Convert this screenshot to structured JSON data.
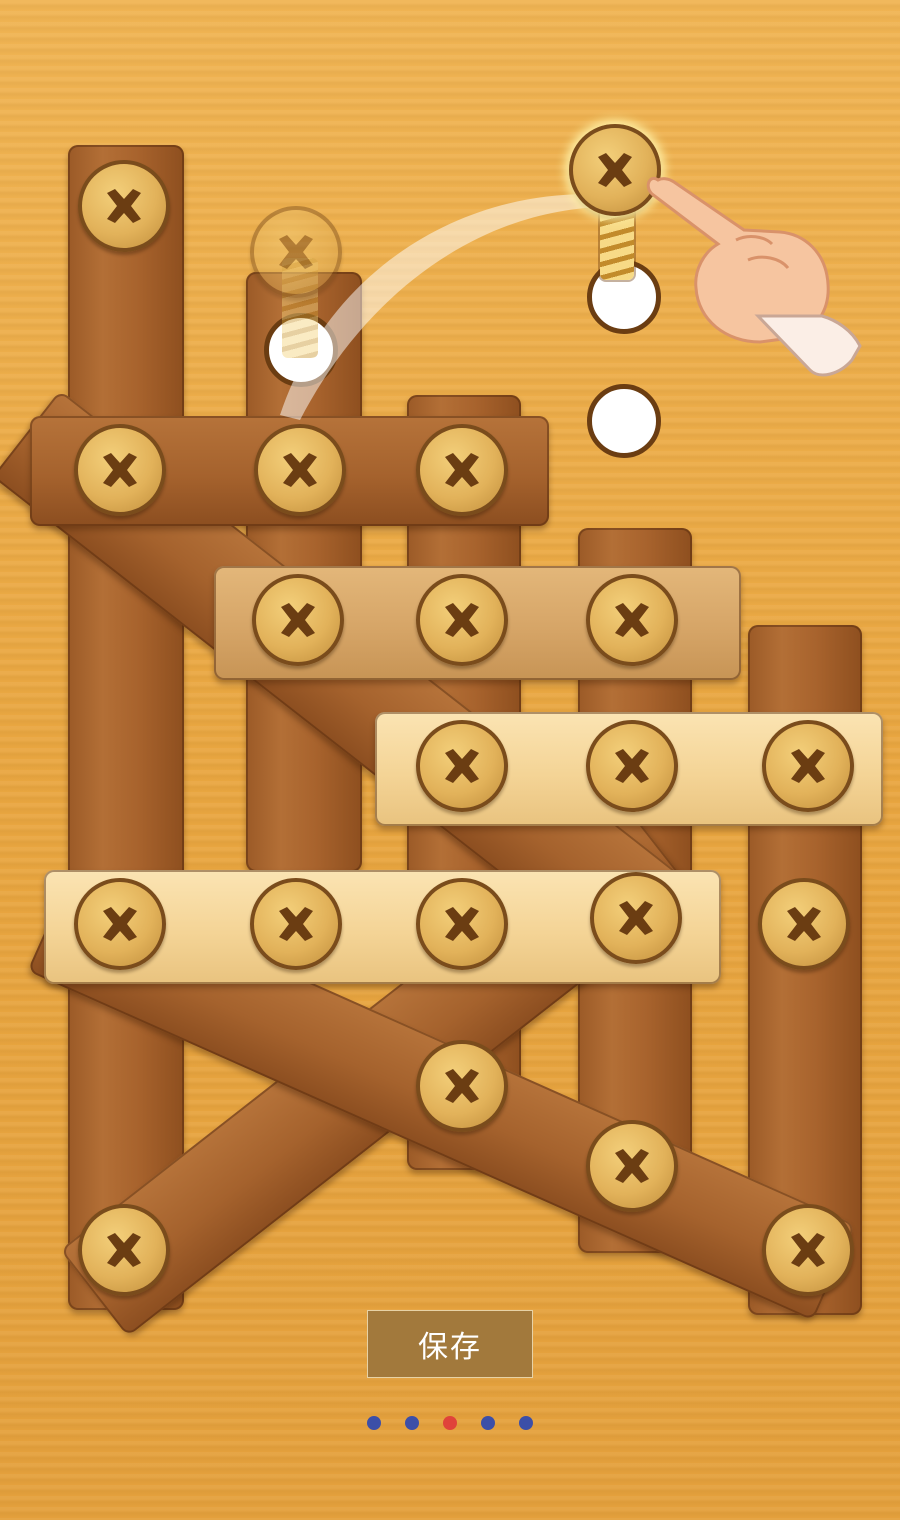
{
  "save_button": {
    "label": "保存"
  },
  "pager": {
    "count": 5,
    "active_index": 2,
    "active_color": "#e0433a",
    "inactive_color": "#3c4fa8"
  },
  "icons": {
    "screw": "cross-screw-icon",
    "hole": "empty-hole-icon",
    "hand": "pointing-hand-icon"
  }
}
